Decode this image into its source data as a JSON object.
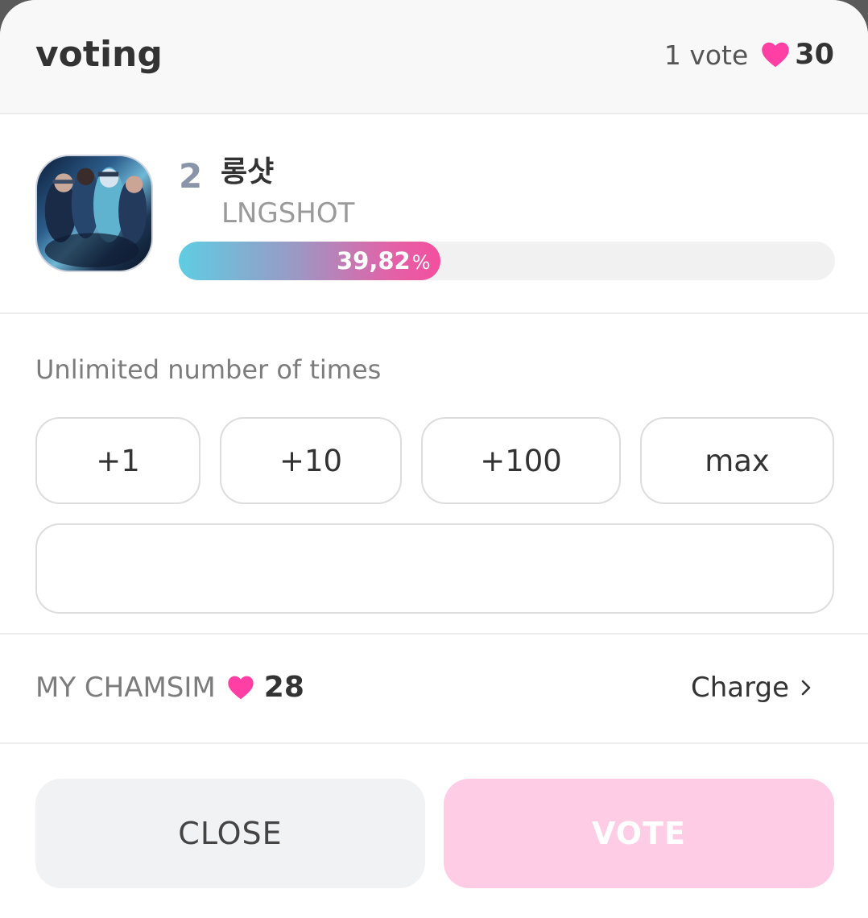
{
  "header": {
    "title": "voting",
    "vote_unit": "1 vote",
    "vote_cost": "30"
  },
  "candidate": {
    "rank": "2",
    "name_ko": "롱샷",
    "name_en": "LNGSHOT",
    "percent_text": "39,82",
    "percent_symbol": "%",
    "percent_value": 39.82
  },
  "voting": {
    "limit_text": "Unlimited number of times",
    "quick_buttons": [
      "+1",
      "+10",
      "+100",
      "max"
    ],
    "amount_value": "",
    "amount_placeholder": ""
  },
  "balance": {
    "label": "MY CHAMSIM",
    "value": "28",
    "charge_label": "Charge"
  },
  "actions": {
    "close_label": "CLOSE",
    "vote_label": "VOTE"
  },
  "colors": {
    "heart": "#ff3fa4",
    "vote_button_disabled": "#fecde5",
    "close_button": "#f1f2f4"
  }
}
